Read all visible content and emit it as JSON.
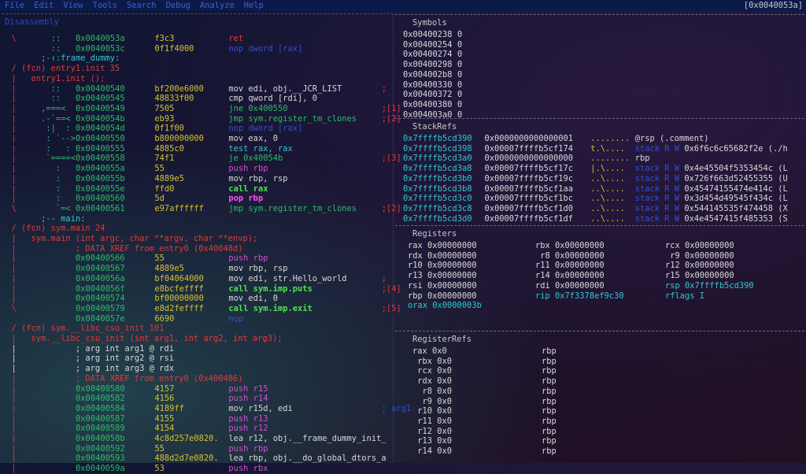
{
  "menu": {
    "items": [
      "File",
      "Edit",
      "View",
      "Tools",
      "Search",
      "Debug",
      "Analyze",
      "Help"
    ],
    "current_address": "[0x0040053a]"
  },
  "disasm": {
    "title": "Disassembly",
    "lines": [
      {
        "g": "  \\     ",
        "d": "  ::   ",
        "a": "0x0040053a",
        "b": "f3c3",
        "i": "ret",
        "ic": "r"
      },
      {
        "g": "        ",
        "d": "  ::   ",
        "a": "0x0040053c",
        "b": "0f1f4000",
        "i": "nop dword [rax]",
        "ic": "bl",
        "ihl": "[rax]"
      },
      {
        "g": "        ",
        "d": "  ::   ",
        "a": "",
        "b": "",
        "i": ";-- frame_dummy:",
        "ic": "cy",
        "ix": 8
      },
      {
        "g": "  / (fcn) entry1.init 35",
        "gc": "r",
        "wfull": true
      },
      {
        "g": "  |   entry1.init ();",
        "gc": "r",
        "wfull": true
      },
      {
        "g": "  |     ",
        "d": "  ::   ",
        "a": "0x00400540",
        "b": "bf200e6000",
        "i": "mov edi, obj.__JCR_LIST",
        "ic": "w",
        "cm": ";",
        "cmc": "r"
      },
      {
        "g": "  |     ",
        "d": "  ::   ",
        "a": "0x00400545",
        "b": "48833f00",
        "i": "cmp qword [rdi], 0",
        "ic": "w"
      },
      {
        "g": "  |   ",
        "d": ",===<  ",
        "a": "0x00400549",
        "b": "7505",
        "i": "jne 0x400550",
        "ic": "g",
        "cm": ";[1]",
        "cmc": "r"
      },
      {
        "g": "  |  ",
        "d": ".-`==<  ",
        "a": "0x0040054b",
        "b": "eb93",
        "i": "jmp sym.register_tm_clones",
        "ic": "g",
        "cm": ";[2]",
        "cmc": "r"
      },
      {
        "g": "  |  ",
        "d": " :|  :  ",
        "a": "0x0040054d",
        "b": "0f1f00",
        "i": "nop dword [rax]",
        "ic": "bl",
        "ihl": "[rax]"
      },
      {
        "g": "  |  ",
        "d": " : `--> ",
        "a": "0x00400550",
        "b": "b800000000",
        "i": "mov eax, 0",
        "ic": "w"
      },
      {
        "g": "  |  ",
        "d": " :   :  ",
        "a": "0x00400555",
        "b": "4885c0",
        "i": "test rax, rax",
        "ic": "cy"
      },
      {
        "g": "  |  ",
        "d": " `====< ",
        "a": "0x00400558",
        "b": "74f1",
        "i": "je 0x40054b",
        "ic": "g",
        "cm": ";[3]",
        "cmc": "r"
      },
      {
        "g": "  |     ",
        "d": "   :   ",
        "a": "0x0040055a",
        "b": "55",
        "i": "push rbp",
        "ic": "m"
      },
      {
        "g": "  |     ",
        "d": "   :   ",
        "a": "0x0040055b",
        "b": "4889e5",
        "i": "mov rbp, rsp",
        "ic": "w"
      },
      {
        "g": "  |     ",
        "d": "   :   ",
        "a": "0x0040055e",
        "b": "ffd0",
        "i": "call rax",
        "ic": "gn"
      },
      {
        "g": "  |     ",
        "d": "   :   ",
        "a": "0x00400560",
        "b": "5d",
        "i": "pop rbp",
        "ic": "pk"
      },
      {
        "g": "  \\     ",
        "d": "   `=< ",
        "a": "0x00400561",
        "b": "e97affffff",
        "i": "jmp sym.register_tm_clones",
        "ic": "g",
        "cm": ";[2]",
        "cmc": "r"
      },
      {
        "g": "        ",
        "d": "       ",
        "a": "",
        "b": "",
        "i": ";-- main:",
        "ic": "cy",
        "ix": 8
      },
      {
        "g": "  / (fcn) sym.main 24",
        "gc": "r",
        "wfull": true
      },
      {
        "g": "  |   sym.main (int argc, char **argv, char **envp);",
        "gc": "r",
        "wfull": true
      },
      {
        "g": "  |            ; DATA XREF from entry0 (0x40048d)",
        "gc": "r",
        "wfull": true
      },
      {
        "g": "  |     ",
        "d": "       ",
        "a": "0x00400566",
        "b": "55",
        "i": "push rbp",
        "ic": "m"
      },
      {
        "g": "  |     ",
        "d": "       ",
        "a": "0x00400567",
        "b": "4889e5",
        "i": "mov rbp, rsp",
        "ic": "w"
      },
      {
        "g": "  |     ",
        "d": "       ",
        "a": "0x0040056a",
        "b": "bf04064000",
        "i": "mov edi, str.Hello_world",
        "ic": "w",
        "cm": ";",
        "cmc": "r"
      },
      {
        "g": "  |     ",
        "d": "       ",
        "a": "0x0040056f",
        "b": "e8bcfeffff",
        "i": "call sym.imp.puts",
        "ic": "gn",
        "cm": ";[4]",
        "cmc": "r"
      },
      {
        "g": "  |     ",
        "d": "       ",
        "a": "0x00400574",
        "b": "bf00000000",
        "i": "mov edi, 0",
        "ic": "w"
      },
      {
        "g": "  \\     ",
        "d": "       ",
        "a": "0x00400579",
        "b": "e8d2feffff",
        "i": "call sym.imp.exit",
        "ic": "gn",
        "cm": ";[5]",
        "cmc": "r"
      },
      {
        "g": "        ",
        "d": "       ",
        "a": "0x0040057e",
        "b": "6690",
        "i": "nop",
        "ic": "bl"
      },
      {
        "g": "  / (fcn) sym.__libc_csu_init 101",
        "gc": "r",
        "wfull": true
      },
      {
        "g": "  |   sym.__libc_csu_init (int arg1, int arg2, int arg3);",
        "gc": "r",
        "wfull": true
      },
      {
        "g": "  |            ; arg int arg1 @ rdi",
        "gc": "w",
        "wfull": true
      },
      {
        "g": "  |            ; arg int arg2 @ rsi",
        "gc": "w",
        "wfull": true
      },
      {
        "g": "  |            ; arg int arg3 @ rdx",
        "gc": "w",
        "wfull": true
      },
      {
        "g": "  |            ; DATA XREF from entry0 (0x400486)",
        "gc": "r",
        "wfull": true
      },
      {
        "g": "  |     ",
        "d": "       ",
        "a": "0x00400580",
        "b": "4157",
        "i": "push r15",
        "ic": "m"
      },
      {
        "g": "  |     ",
        "d": "       ",
        "a": "0x00400582",
        "b": "4156",
        "i": "push r14",
        "ic": "m"
      },
      {
        "g": "  |     ",
        "d": "       ",
        "a": "0x00400584",
        "b": "4189ff",
        "i": "mov r15d, edi",
        "ic": "w",
        "cm": "; arg1",
        "cmc": "bl"
      },
      {
        "g": "  |     ",
        "d": "       ",
        "a": "0x00400587",
        "b": "4155",
        "i": "push r13",
        "ic": "m"
      },
      {
        "g": "  |     ",
        "d": "       ",
        "a": "0x00400589",
        "b": "4154",
        "i": "push r12",
        "ic": "m"
      },
      {
        "g": "  |     ",
        "d": "       ",
        "a": "0x0040058b",
        "b": "4c8d257e0820.",
        "i": "lea r12, obj.__frame_dummy_init_",
        "ic": "w"
      },
      {
        "g": "  |     ",
        "d": "       ",
        "a": "0x00400592",
        "b": "55",
        "i": "push rbp",
        "ic": "m"
      },
      {
        "g": "  |     ",
        "d": "       ",
        "a": "0x00400593",
        "b": "488d2d7e0820.",
        "i": "lea rbp, obj.__do_global_dtors_a",
        "ic": "w"
      },
      {
        "g": "  |     ",
        "d": "       ",
        "a": "0x0040059a",
        "b": "53",
        "i": "push rbx",
        "ic": "m"
      }
    ]
  },
  "symbols": {
    "title": "Symbols",
    "rows": [
      [
        "0x00400238",
        "0"
      ],
      [
        "0x00400254",
        "0"
      ],
      [
        "0x00400274",
        "0"
      ],
      [
        "0x00400298",
        "0"
      ],
      [
        "0x004002b8",
        "0"
      ],
      [
        "0x00400330",
        "0"
      ],
      [
        "0x00400372",
        "0"
      ],
      [
        "0x00400380",
        "0"
      ],
      [
        "0x004003a0",
        "0"
      ]
    ]
  },
  "stackrefs": {
    "title": "StackRefs",
    "rows": [
      [
        "0x7ffffb5cd390",
        "0x0000000000000001",
        "........",
        "@rsp (.comment)",
        ""
      ],
      [
        "0x7ffffb5cd398",
        "0x00007ffffb5cf174",
        "t.\\....",
        "stack R W",
        "0x6f6c6c65682f2e (./h"
      ],
      [
        "0x7ffffb5cd3a0",
        "0x0000000000000000",
        "........",
        "rbp",
        ""
      ],
      [
        "0x7ffffb5cd3a8",
        "0x00007ffffb5cf17c",
        "|.\\....",
        "stack R W",
        "0x4e45504f5353454c (L"
      ],
      [
        "0x7ffffb5cd3b0",
        "0x00007ffffb5cf19c",
        "..\\....",
        "stack R W",
        "0x726f663d52455355 (U"
      ],
      [
        "0x7ffffb5cd3b8",
        "0x00007ffffb5cf1aa",
        "..\\....",
        "stack R W",
        "0x45474155474e414c (L"
      ],
      [
        "0x7ffffb5cd3c0",
        "0x00007ffffb5cf1bc",
        "..\\....",
        "stack R W",
        "0x3d454d49545f434c (L"
      ],
      [
        "0x7ffffb5cd3c8",
        "0x00007ffffb5cf1d0",
        "..\\....",
        "stack R W",
        "0x544145535f474458 (X"
      ],
      [
        "0x7ffffb5cd3d0",
        "0x00007ffffb5cf1df",
        "..\\....",
        "stack R W",
        "0x4e4547415f485353 (S"
      ]
    ]
  },
  "registers": {
    "title": "Registers",
    "rows": [
      [
        {
          "t": "rax 0x00000000",
          "c": "w"
        },
        {
          "t": "rbx 0x00000000",
          "c": "w"
        },
        {
          "t": "rcx 0x00000000",
          "c": "w"
        }
      ],
      [
        {
          "t": "rdx 0x00000000",
          "c": "w"
        },
        {
          "t": " r8 0x00000000",
          "c": "w"
        },
        {
          "t": " r9 0x00000000",
          "c": "w"
        }
      ],
      [
        {
          "t": "r10 0x00000000",
          "c": "w"
        },
        {
          "t": "r11 0x00000000",
          "c": "w"
        },
        {
          "t": "r12 0x00000000",
          "c": "w"
        }
      ],
      [
        {
          "t": "r13 0x00000000",
          "c": "w"
        },
        {
          "t": "r14 0x00000000",
          "c": "w"
        },
        {
          "t": "r15 0x00000000",
          "c": "w"
        }
      ],
      [
        {
          "t": "rsi 0x00000000",
          "c": "w"
        },
        {
          "t": "rdi 0x00000000",
          "c": "w"
        },
        {
          "t": "rsp 0x7ffffb5cd390",
          "c": "cy"
        }
      ],
      [
        {
          "t": "rbp 0x00000000",
          "c": "w"
        },
        {
          "t": "rip 0x7f3378ef9c30",
          "c": "cy"
        },
        {
          "t": "rflags I",
          "c": "cy"
        }
      ],
      [
        {
          "t": "orax 0x0000003b",
          "c": "cy"
        }
      ]
    ]
  },
  "registerrefs": {
    "title": "RegisterRefs",
    "rows": [
      [
        "rax 0x0",
        "rbp"
      ],
      [
        " rbx 0x0",
        "rbp"
      ],
      [
        " rcx 0x0",
        "rbp"
      ],
      [
        " rdx 0x0",
        "rbp"
      ],
      [
        "  r8 0x0",
        "rbp"
      ],
      [
        "  r9 0x0",
        "rbp"
      ],
      [
        " r10 0x0",
        "rbp"
      ],
      [
        " r11 0x0",
        "rbp"
      ],
      [
        " r12 0x0",
        "rbp"
      ],
      [
        " r13 0x0",
        "rbp"
      ],
      [
        " r14 0x0",
        "rbp"
      ]
    ]
  }
}
